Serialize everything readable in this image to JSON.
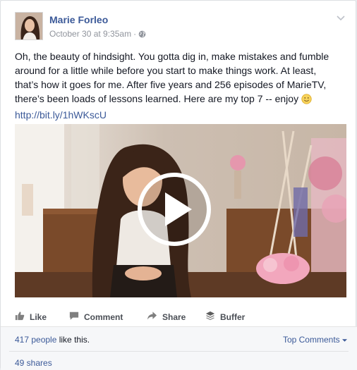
{
  "post": {
    "author": "Marie Forleo",
    "timestamp": "October 30 at 9:35am",
    "separator": "·",
    "text_lines": [
      "Oh, the beauty of hindsight. You gotta dig in, make mistakes and fumble",
      "around for a little while before you start to make things work. At least,",
      "that’s how it goes for me. After five years and 256 episodes of MarieTV,",
      "there’s been loads of lessons learned. Here are my top 7 -- enjoy"
    ],
    "link": "http://bit.ly/1hWKscU"
  },
  "actions": {
    "like": "Like",
    "comment": "Comment",
    "share": "Share",
    "buffer": "Buffer"
  },
  "stats": {
    "likes_count": "417 people",
    "likes_suffix": " like this.",
    "top_comments": "Top Comments",
    "shares": "49 shares"
  },
  "colors": {
    "link": "#3b5998",
    "secondary": "#90949c",
    "action": "#4b4f56"
  }
}
